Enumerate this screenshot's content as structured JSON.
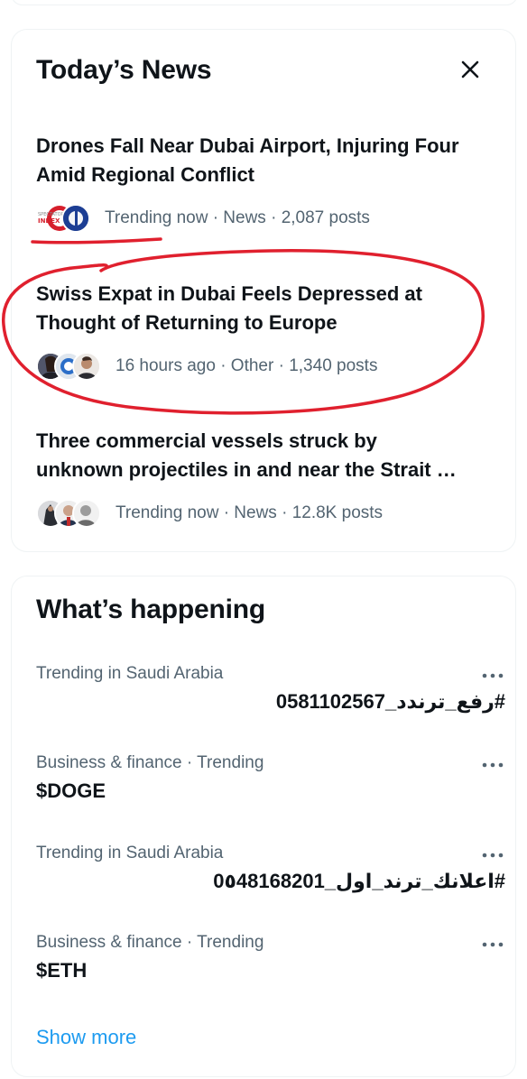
{
  "todays_news": {
    "title": "Today’s News",
    "items": [
      {
        "headline": "Drones Fall Near Dubai Airport, Injuring Four Amid Regional Conflict",
        "meta": "Trending now · News · 2,087 posts",
        "avatar_text": "SPECTATOR INDEX"
      },
      {
        "headline": "Swiss Expat in Dubai Feels Depressed at Thought of Returning to Europe",
        "meta": "16 hours ago · Other · 1,340 posts"
      },
      {
        "headline": "Three commercial vessels struck by unknown projectiles in and near the Strait of Hormuz",
        "meta": "Trending now · News · 12.8K posts"
      }
    ]
  },
  "whats_happening": {
    "title": "What’s happening",
    "trends": [
      {
        "context": "Trending in Saudi Arabia",
        "name": "#رفع_ترندد_0581102567",
        "rtl": true
      },
      {
        "context": "Business & finance · Trending",
        "name": "$DOGE",
        "rtl": false
      },
      {
        "context": "Trending in Saudi Arabia",
        "name": "#اعلانك_ترند_اول_0٥48168201",
        "rtl": true
      },
      {
        "context": "Business & finance · Trending",
        "name": "$ETH",
        "rtl": false
      }
    ],
    "show_more": "Show more"
  },
  "colors": {
    "accent": "#1d9bf0",
    "secondary_text": "#536471",
    "annotation": "#e0202e"
  },
  "icons": [
    "close-icon",
    "more-icon"
  ]
}
